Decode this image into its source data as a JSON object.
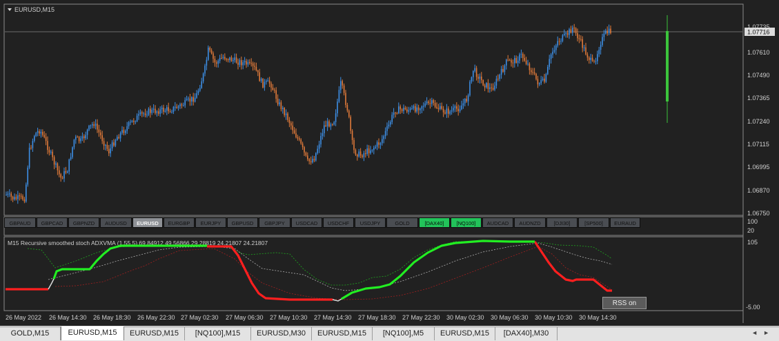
{
  "symbol_title": "EURUSD,M15",
  "icons": {
    "dropdown": "triangle-down-icon"
  },
  "colors": {
    "bull": "#3d8fe6",
    "bear": "#e07a3a",
    "signal_up": "#22ee22",
    "signal_down": "#ff1f1f",
    "upper_band": "#1fa81f",
    "lower_band": "#a32020",
    "mid_band": "#b0b0b0",
    "current_bar": "#3cc43c"
  },
  "price_axis": {
    "ticks": [
      "1.07735",
      "1.07610",
      "1.07490",
      "1.07365",
      "1.07240",
      "1.07115",
      "1.06995",
      "1.06870",
      "1.06750"
    ],
    "current_price": "1.07716"
  },
  "symbols": [
    {
      "label": "GBPAUD",
      "state": ""
    },
    {
      "label": "GBPCAD",
      "state": ""
    },
    {
      "label": "GBPNZD",
      "state": ""
    },
    {
      "label": "AUDUSD",
      "state": ""
    },
    {
      "label": "EURUSD",
      "state": "active"
    },
    {
      "label": "EURGBP",
      "state": ""
    },
    {
      "label": "EURJPY",
      "state": ""
    },
    {
      "label": "GBPUSD",
      "state": ""
    },
    {
      "label": "GBPJPY",
      "state": ""
    },
    {
      "label": "USDCAD",
      "state": ""
    },
    {
      "label": "USDCHF",
      "state": ""
    },
    {
      "label": "USDJPY",
      "state": ""
    },
    {
      "label": "GOLD",
      "state": ""
    },
    {
      "label": "[DAX40]",
      "state": "green"
    },
    {
      "label": "[NQ100]",
      "state": "green"
    },
    {
      "label": "AUDCAD",
      "state": ""
    },
    {
      "label": "AUDNZD",
      "state": ""
    },
    {
      "label": "[DJI30]",
      "state": ""
    },
    {
      "label": "[SP500]",
      "state": ""
    },
    {
      "label": "EURAUD",
      "state": ""
    }
  ],
  "strip_axis": {
    "upper": "100",
    "lower": "20"
  },
  "indicator": {
    "label": "M15  Recursive smoothed stoch ADXVMA (1,55,5) 69.84912 49.56866 29.28819 24.21807 24.21807",
    "axis_top": "105",
    "axis_bottom": "-5.00",
    "rss_label": "RSS on"
  },
  "time_axis": [
    "26 May 2022",
    "26 May 14:30",
    "26 May 18:30",
    "26 May 22:30",
    "27 May 02:30",
    "27 May 06:30",
    "27 May 10:30",
    "27 May 14:30",
    "27 May 18:30",
    "27 May 22:30",
    "30 May 02:30",
    "30 May 06:30",
    "30 May 10:30",
    "30 May 14:30"
  ],
  "tabs": [
    {
      "label": "GOLD,M15",
      "active": false
    },
    {
      "label": "EURUSD,M15",
      "active": true
    },
    {
      "label": "EURUSD,M15",
      "active": false
    },
    {
      "label": "[NQ100],M15",
      "active": false
    },
    {
      "label": "EURUSD,M30",
      "active": false
    },
    {
      "label": "EURUSD,M15",
      "active": false
    },
    {
      "label": "[NQ100],M5",
      "active": false
    },
    {
      "label": "EURUSD,M15",
      "active": false
    },
    {
      "label": "[DAX40],M30",
      "active": false
    }
  ],
  "tab_nav": {
    "left": "◄",
    "right": "►"
  }
}
